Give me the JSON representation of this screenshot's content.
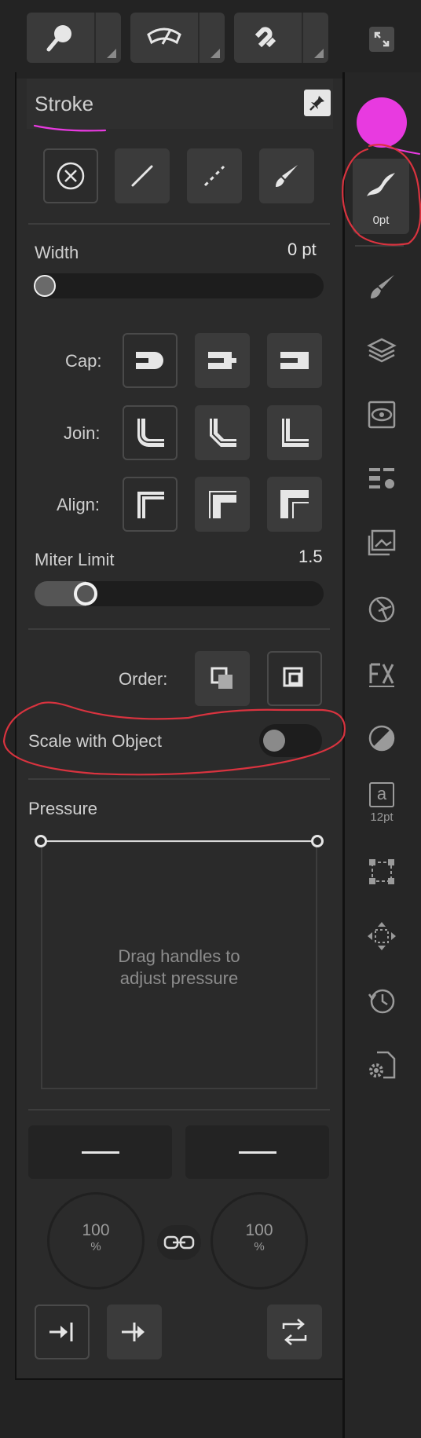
{
  "toolbar": {
    "items": [
      "zoom-tool",
      "view-mode",
      "snapping"
    ],
    "fullscreen_icon": "expand-icon"
  },
  "stroke_panel": {
    "title": "Stroke",
    "style_buttons": [
      "none",
      "solid",
      "dashed",
      "brush"
    ],
    "width_label": "Width",
    "width_value": "0 pt",
    "width_fraction": 0.0,
    "cap_label": "Cap:",
    "join_label": "Join:",
    "align_label": "Align:",
    "miter_label": "Miter Limit",
    "miter_value": "1.5",
    "miter_fraction": 0.18,
    "order_label": "Order:",
    "scale_label": "Scale with Object",
    "scale_on": false,
    "pressure_label": "Pressure",
    "pressure_hint_line1": "Drag handles to",
    "pressure_hint_line2": "adjust pressure",
    "start_pct": "100",
    "end_pct": "100",
    "pct_unit": "%"
  },
  "sidebar": {
    "color": "#e83ae0",
    "stroke_size_label": "0pt",
    "text_size_label": "12pt",
    "text_glyph": "a"
  },
  "colors": {
    "annotation_red": "#d9333f",
    "annotation_magenta": "#e83ae0"
  }
}
